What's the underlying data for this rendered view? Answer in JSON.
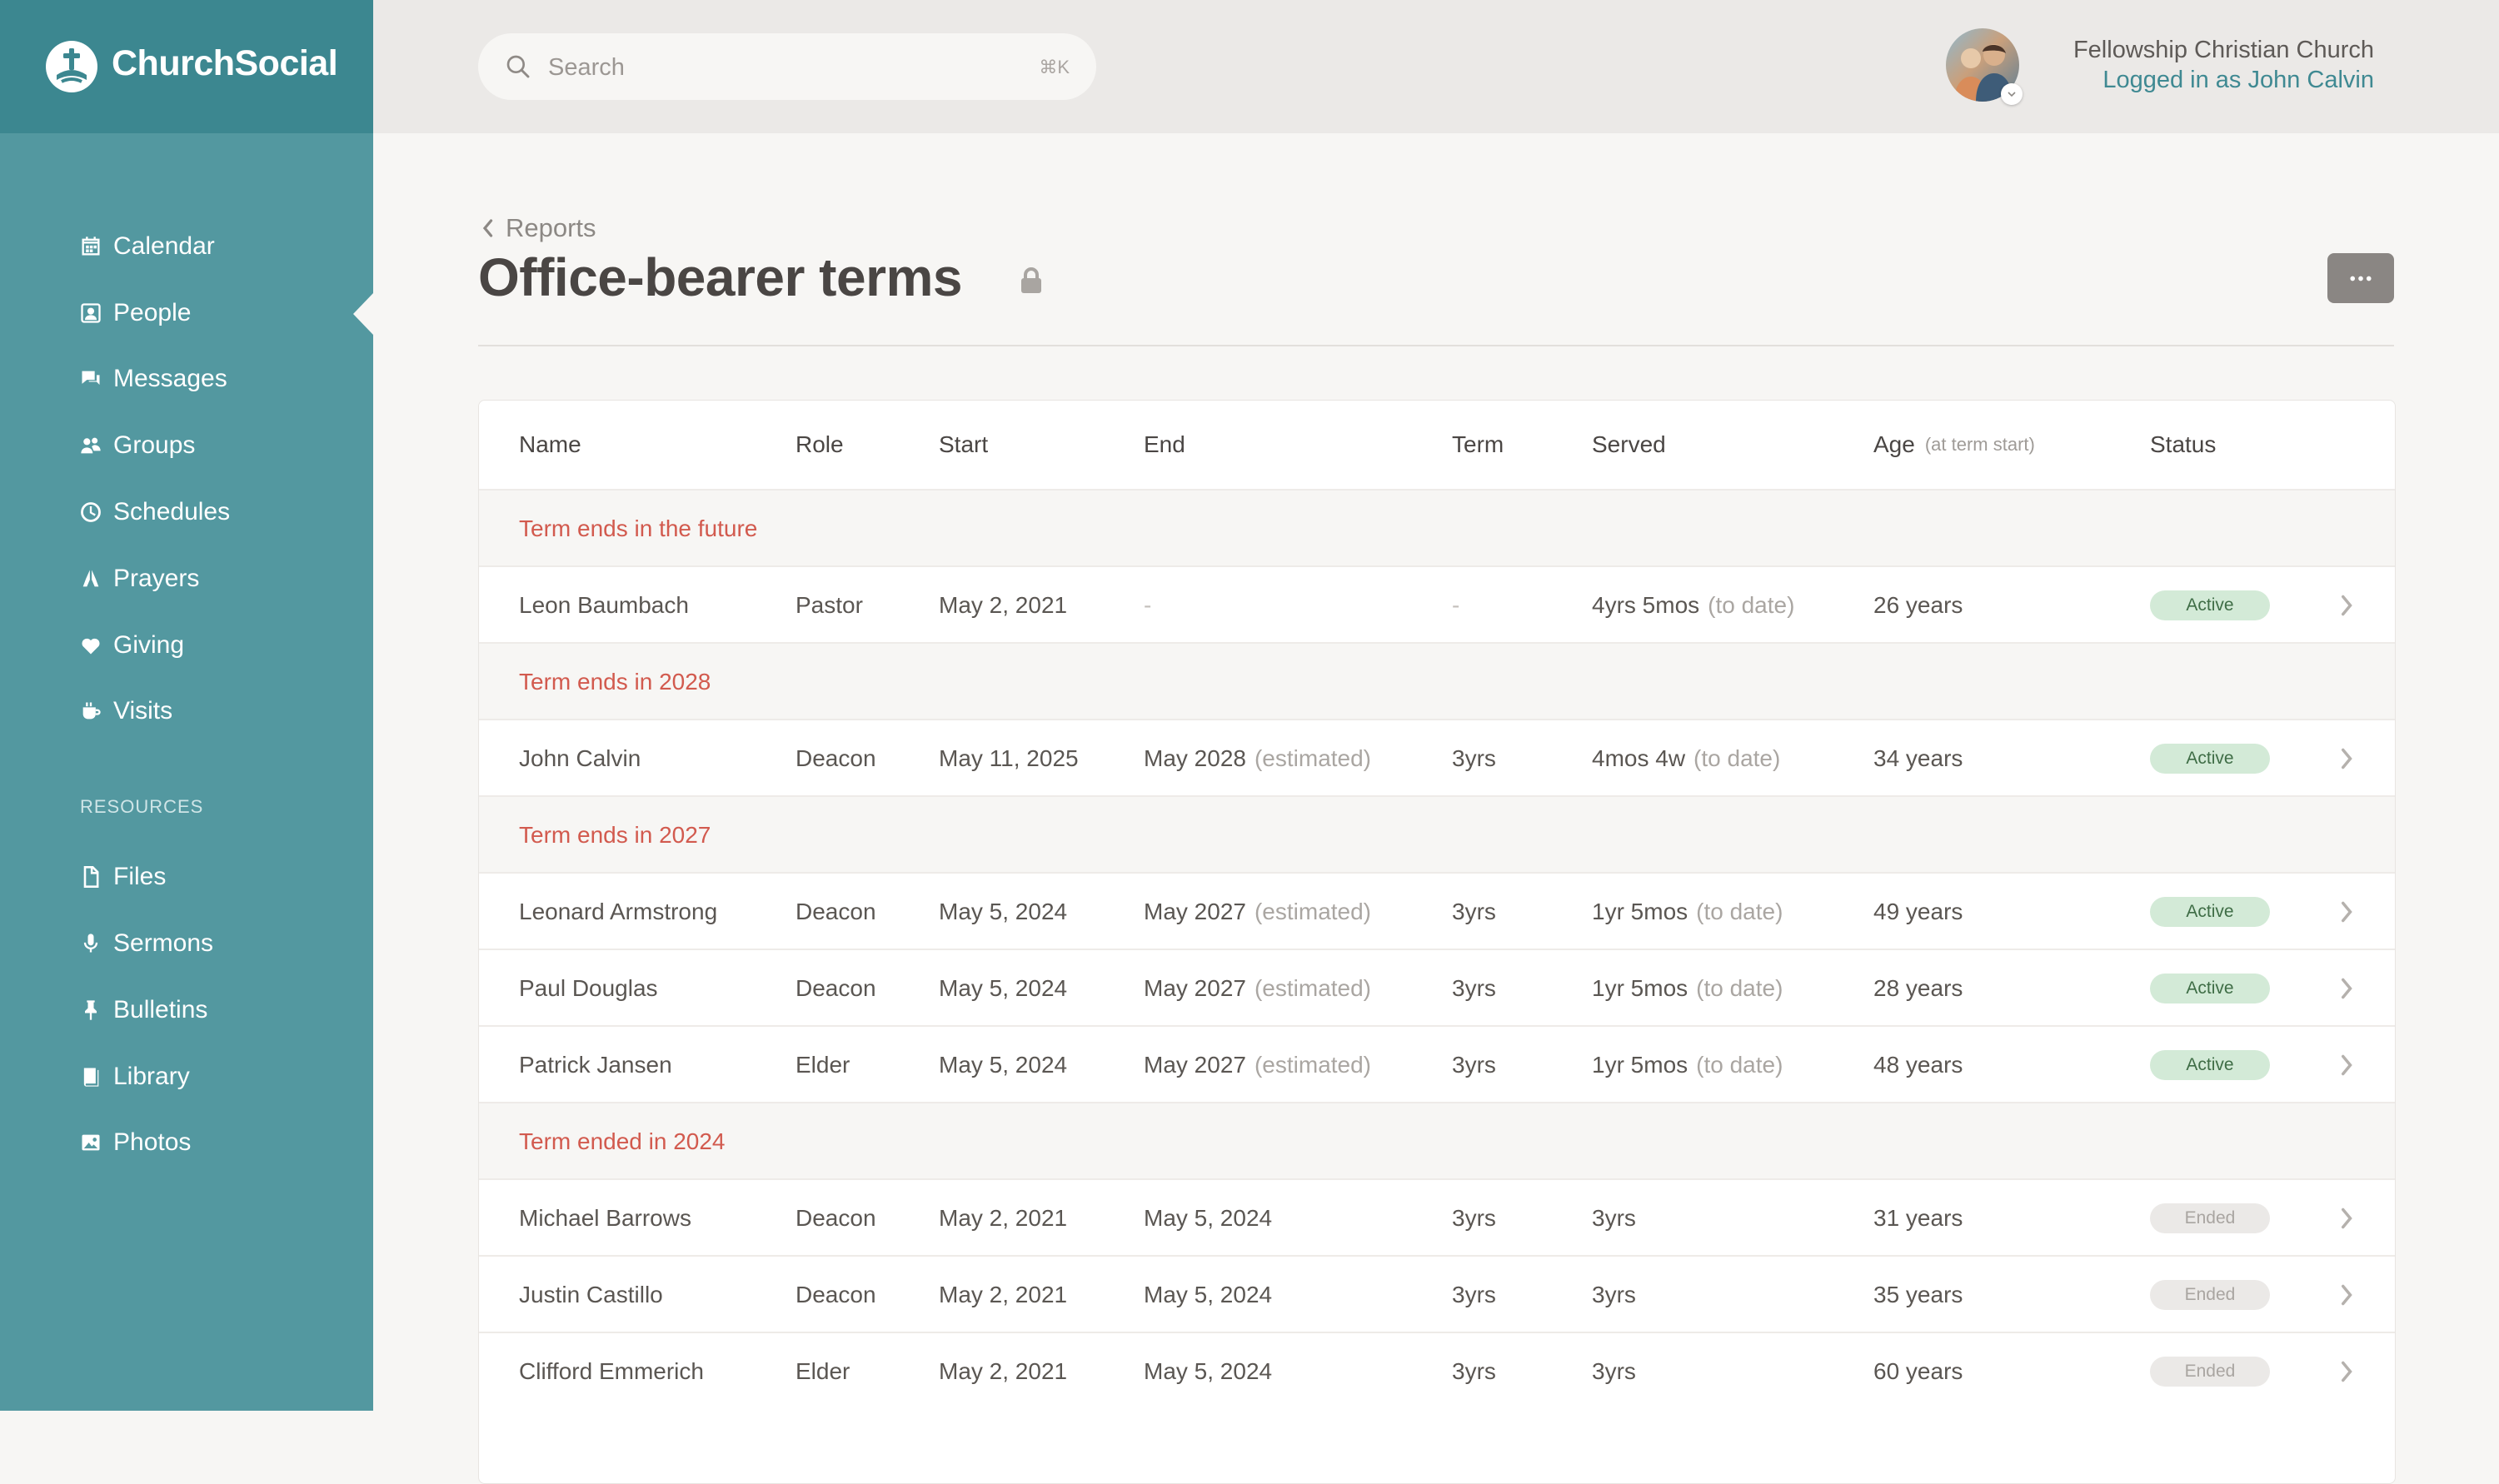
{
  "brand": {
    "name": "ChurchSocial"
  },
  "sidebar": {
    "items": [
      {
        "label": "Calendar",
        "icon": "calendar-icon"
      },
      {
        "label": "People",
        "icon": "person-icon"
      },
      {
        "label": "Messages",
        "icon": "chat-icon"
      },
      {
        "label": "Groups",
        "icon": "groups-icon"
      },
      {
        "label": "Schedules",
        "icon": "clock-icon"
      },
      {
        "label": "Prayers",
        "icon": "prayer-hands-icon"
      },
      {
        "label": "Giving",
        "icon": "heart-icon"
      },
      {
        "label": "Visits",
        "icon": "coffee-cup-icon"
      }
    ],
    "resources_heading": "RESOURCES",
    "resources": [
      {
        "label": "Files",
        "icon": "file-icon"
      },
      {
        "label": "Sermons",
        "icon": "microphone-icon"
      },
      {
        "label": "Bulletins",
        "icon": "pin-icon"
      },
      {
        "label": "Library",
        "icon": "book-icon"
      },
      {
        "label": "Photos",
        "icon": "image-icon"
      }
    ],
    "active": "People"
  },
  "header": {
    "search": {
      "placeholder": "Search",
      "shortcut": "⌘K"
    },
    "church_name": "Fellowship Christian Church",
    "login_text": "Logged in as John Calvin"
  },
  "page": {
    "breadcrumb": "Reports",
    "title": "Office-bearer terms"
  },
  "table": {
    "columns": {
      "name": "Name",
      "role": "Role",
      "start": "Start",
      "end": "End",
      "term": "Term",
      "served": "Served",
      "age": "Age",
      "age_hint": "(at term start)",
      "status": "Status"
    },
    "groups": [
      {
        "label": "Term ends in the future",
        "rows": [
          {
            "name": "Leon Baumbach",
            "role": "Pastor",
            "start": "May 2, 2021",
            "end": "-",
            "end_note": "",
            "term": "-",
            "served": "4yrs 5mos",
            "served_note": "(to date)",
            "age": "26 years",
            "status": "Active"
          }
        ]
      },
      {
        "label": "Term ends in 2028",
        "rows": [
          {
            "name": "John Calvin",
            "role": "Deacon",
            "start": "May 11, 2025",
            "end": "May 2028",
            "end_note": "(estimated)",
            "term": "3yrs",
            "served": "4mos 4w",
            "served_note": "(to date)",
            "age": "34 years",
            "status": "Active"
          }
        ]
      },
      {
        "label": "Term ends in 2027",
        "rows": [
          {
            "name": "Leonard Armstrong",
            "role": "Deacon",
            "start": "May 5, 2024",
            "end": "May 2027",
            "end_note": "(estimated)",
            "term": "3yrs",
            "served": "1yr 5mos",
            "served_note": "(to date)",
            "age": "49 years",
            "status": "Active"
          },
          {
            "name": "Paul Douglas",
            "role": "Deacon",
            "start": "May 5, 2024",
            "end": "May 2027",
            "end_note": "(estimated)",
            "term": "3yrs",
            "served": "1yr 5mos",
            "served_note": "(to date)",
            "age": "28 years",
            "status": "Active"
          },
          {
            "name": "Patrick Jansen",
            "role": "Elder",
            "start": "May 5, 2024",
            "end": "May 2027",
            "end_note": "(estimated)",
            "term": "3yrs",
            "served": "1yr 5mos",
            "served_note": "(to date)",
            "age": "48 years",
            "status": "Active"
          }
        ]
      },
      {
        "label": "Term ended in 2024",
        "rows": [
          {
            "name": "Michael Barrows",
            "role": "Deacon",
            "start": "May 2, 2021",
            "end": "May 5, 2024",
            "end_note": "",
            "term": "3yrs",
            "served": "3yrs",
            "served_note": "",
            "age": "31 years",
            "status": "Ended"
          },
          {
            "name": "Justin Castillo",
            "role": "Deacon",
            "start": "May 2, 2021",
            "end": "May 5, 2024",
            "end_note": "",
            "term": "3yrs",
            "served": "3yrs",
            "served_note": "",
            "age": "35 years",
            "status": "Ended"
          },
          {
            "name": "Clifford Emmerich",
            "role": "Elder",
            "start": "May 2, 2021",
            "end": "May 5, 2024",
            "end_note": "",
            "term": "3yrs",
            "served": "3yrs",
            "served_note": "",
            "age": "60 years",
            "status": "Ended"
          }
        ]
      }
    ]
  },
  "colors": {
    "sidebar": "#5398a0",
    "brand_bar": "#3c8790",
    "group_label": "#d25a4e",
    "link": "#3f8992",
    "badge_active": "#d3ead7",
    "badge_ended": "#ebe9e7"
  }
}
